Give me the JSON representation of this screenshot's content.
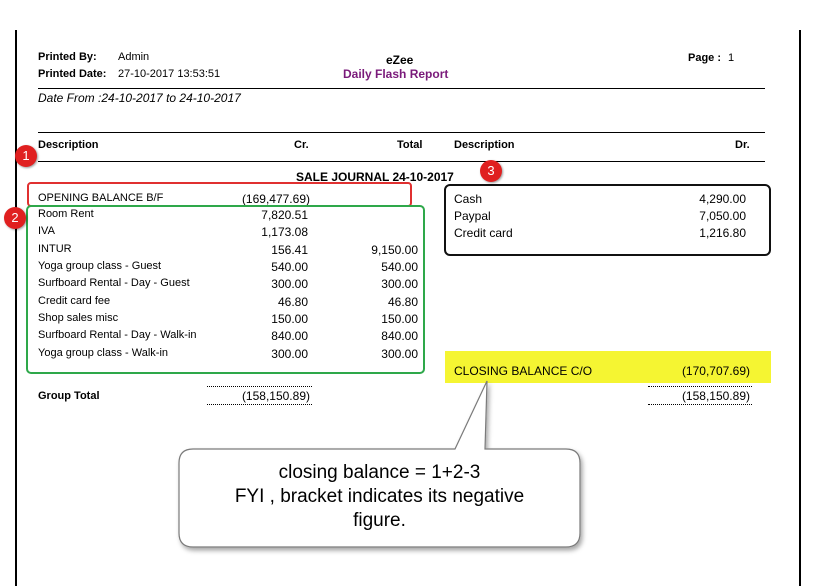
{
  "header": {
    "printed_by_label": "Printed By:",
    "printed_by_value": "Admin",
    "printed_date_label": "Printed Date:",
    "printed_date_value": "27-10-2017 13:53:51",
    "company": "eZee",
    "report_title": "Daily Flash Report",
    "page_label": "Page :",
    "page_value": "1",
    "date_range": "Date From :24-10-2017 to 24-10-2017"
  },
  "columns": {
    "left_description": "Description",
    "cr": "Cr.",
    "total": "Total",
    "right_description": "Description",
    "dr": "Dr."
  },
  "section_title": "SALE JOURNAL 24-10-2017",
  "opening_balance": {
    "label": "OPENING BALANCE B/F",
    "cr": "(169,477.69)"
  },
  "credit_rows": [
    {
      "description": "Room Rent",
      "cr": "7,820.51",
      "total": ""
    },
    {
      "description": "IVA",
      "cr": "1,173.08",
      "total": ""
    },
    {
      "description": "INTUR",
      "cr": "156.41",
      "total": "9,150.00"
    },
    {
      "description": "Yoga group class - Guest",
      "cr": "540.00",
      "total": "540.00"
    },
    {
      "description": "Surfboard Rental - Day - Guest",
      "cr": "300.00",
      "total": "300.00"
    },
    {
      "description": "Credit card fee",
      "cr": "46.80",
      "total": "46.80"
    },
    {
      "description": "Shop sales misc",
      "cr": "150.00",
      "total": "150.00"
    },
    {
      "description": "Surfboard Rental - Day - Walk-in",
      "cr": "840.00",
      "total": "840.00"
    },
    {
      "description": "Yoga group class - Walk-in",
      "cr": "300.00",
      "total": "300.00"
    }
  ],
  "debit_rows": [
    {
      "description": "Cash",
      "dr": "4,290.00"
    },
    {
      "description": "Paypal",
      "dr": "7,050.00"
    },
    {
      "description": "Credit card",
      "dr": "1,216.80"
    }
  ],
  "closing_balance": {
    "label": "CLOSING BALANCE C/O",
    "dr": "(170,707.69)"
  },
  "group_total": {
    "label": "Group Total",
    "cr": "(158,150.89)",
    "dr": "(158,150.89)"
  },
  "markers": [
    "1",
    "2",
    "3"
  ],
  "callout": {
    "line1": "closing balance =  1+2-3",
    "line2": "FYI , bracket indicates its negative",
    "line3": "figure."
  },
  "colors": {
    "title_purple": "#7a1a7a",
    "box1_red": "#e03030",
    "box2_green": "#2ea84a",
    "box3_black": "#111111",
    "closing_highlight": "#f5f532",
    "marker_red": "#e02020"
  }
}
